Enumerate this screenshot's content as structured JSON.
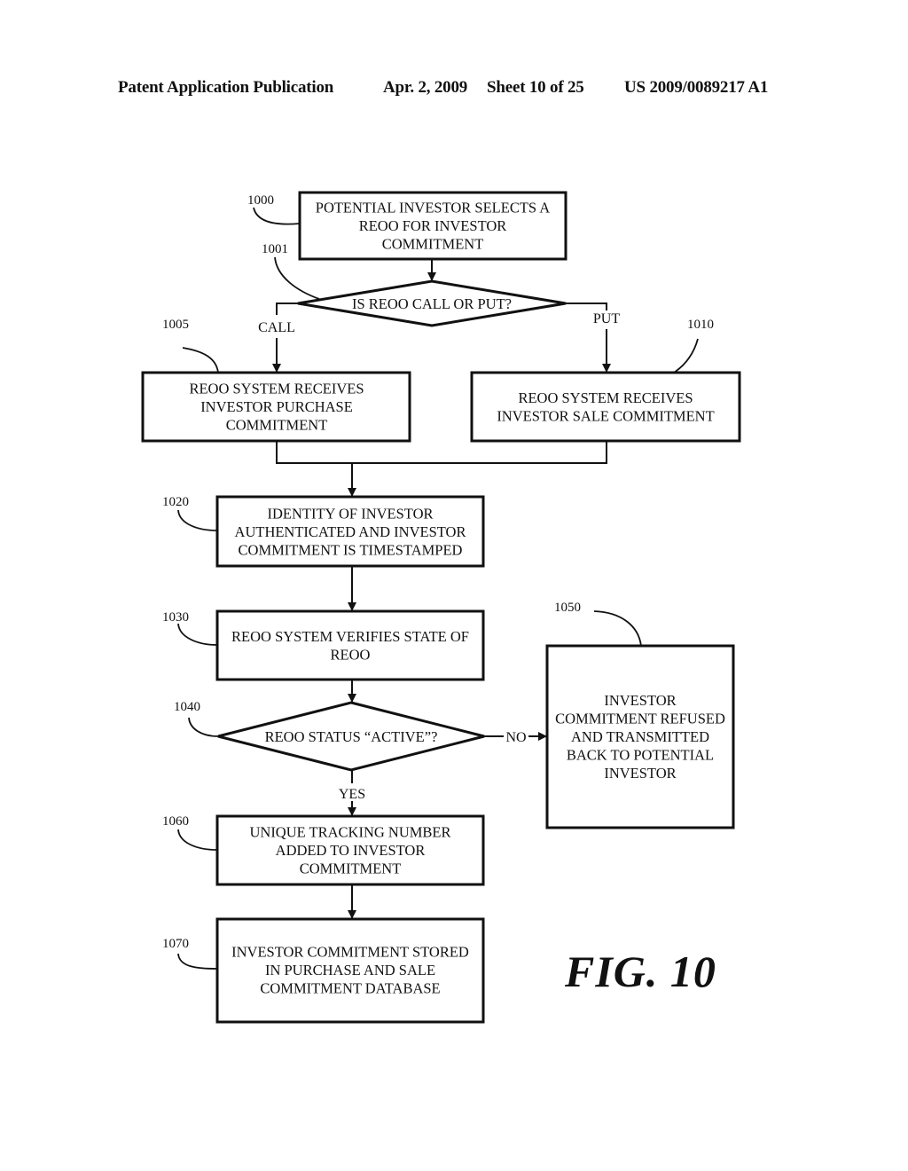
{
  "header": {
    "left": "Patent Application Publication",
    "date": "Apr. 2, 2009",
    "sheet": "Sheet 10 of 25",
    "number": "US 2009/0089217 A1"
  },
  "figure_label": "FIG. 10",
  "nodes": {
    "n1000": {
      "ref": "1000",
      "lines": [
        "POTENTIAL INVESTOR SELECTS A",
        "REOO FOR INVESTOR",
        "COMMITMENT"
      ]
    },
    "n1001": {
      "ref": "1001",
      "lines": [
        "IS REOO CALL OR PUT?"
      ]
    },
    "n1005": {
      "ref": "1005",
      "lines": [
        "REOO SYSTEM RECEIVES",
        "INVESTOR PURCHASE",
        "COMMITMENT"
      ]
    },
    "n1010": {
      "ref": "1010",
      "lines": [
        "REOO SYSTEM RECEIVES",
        "INVESTOR SALE COMMITMENT"
      ]
    },
    "n1020": {
      "ref": "1020",
      "lines": [
        "IDENTITY OF INVESTOR",
        "AUTHENTICATED AND INVESTOR",
        "COMMITMENT IS TIMESTAMPED"
      ]
    },
    "n1030": {
      "ref": "1030",
      "lines": [
        "REOO SYSTEM VERIFIES STATE OF",
        "REOO"
      ]
    },
    "n1040": {
      "ref": "1040",
      "lines": [
        "REOO STATUS “ACTIVE”?"
      ]
    },
    "n1050": {
      "ref": "1050",
      "lines": [
        "INVESTOR",
        "COMMITMENT REFUSED",
        "AND TRANSMITTED",
        "BACK TO POTENTIAL",
        "INVESTOR"
      ]
    },
    "n1060": {
      "ref": "1060",
      "lines": [
        "UNIQUE TRACKING NUMBER",
        "ADDED TO INVESTOR",
        "COMMITMENT"
      ]
    },
    "n1070": {
      "ref": "1070",
      "lines": [
        "INVESTOR COMMITMENT STORED",
        "IN PURCHASE AND SALE",
        "COMMITMENT DATABASE"
      ]
    }
  },
  "edge_labels": {
    "call": "CALL",
    "put": "PUT",
    "no": "NO",
    "yes": "YES"
  }
}
